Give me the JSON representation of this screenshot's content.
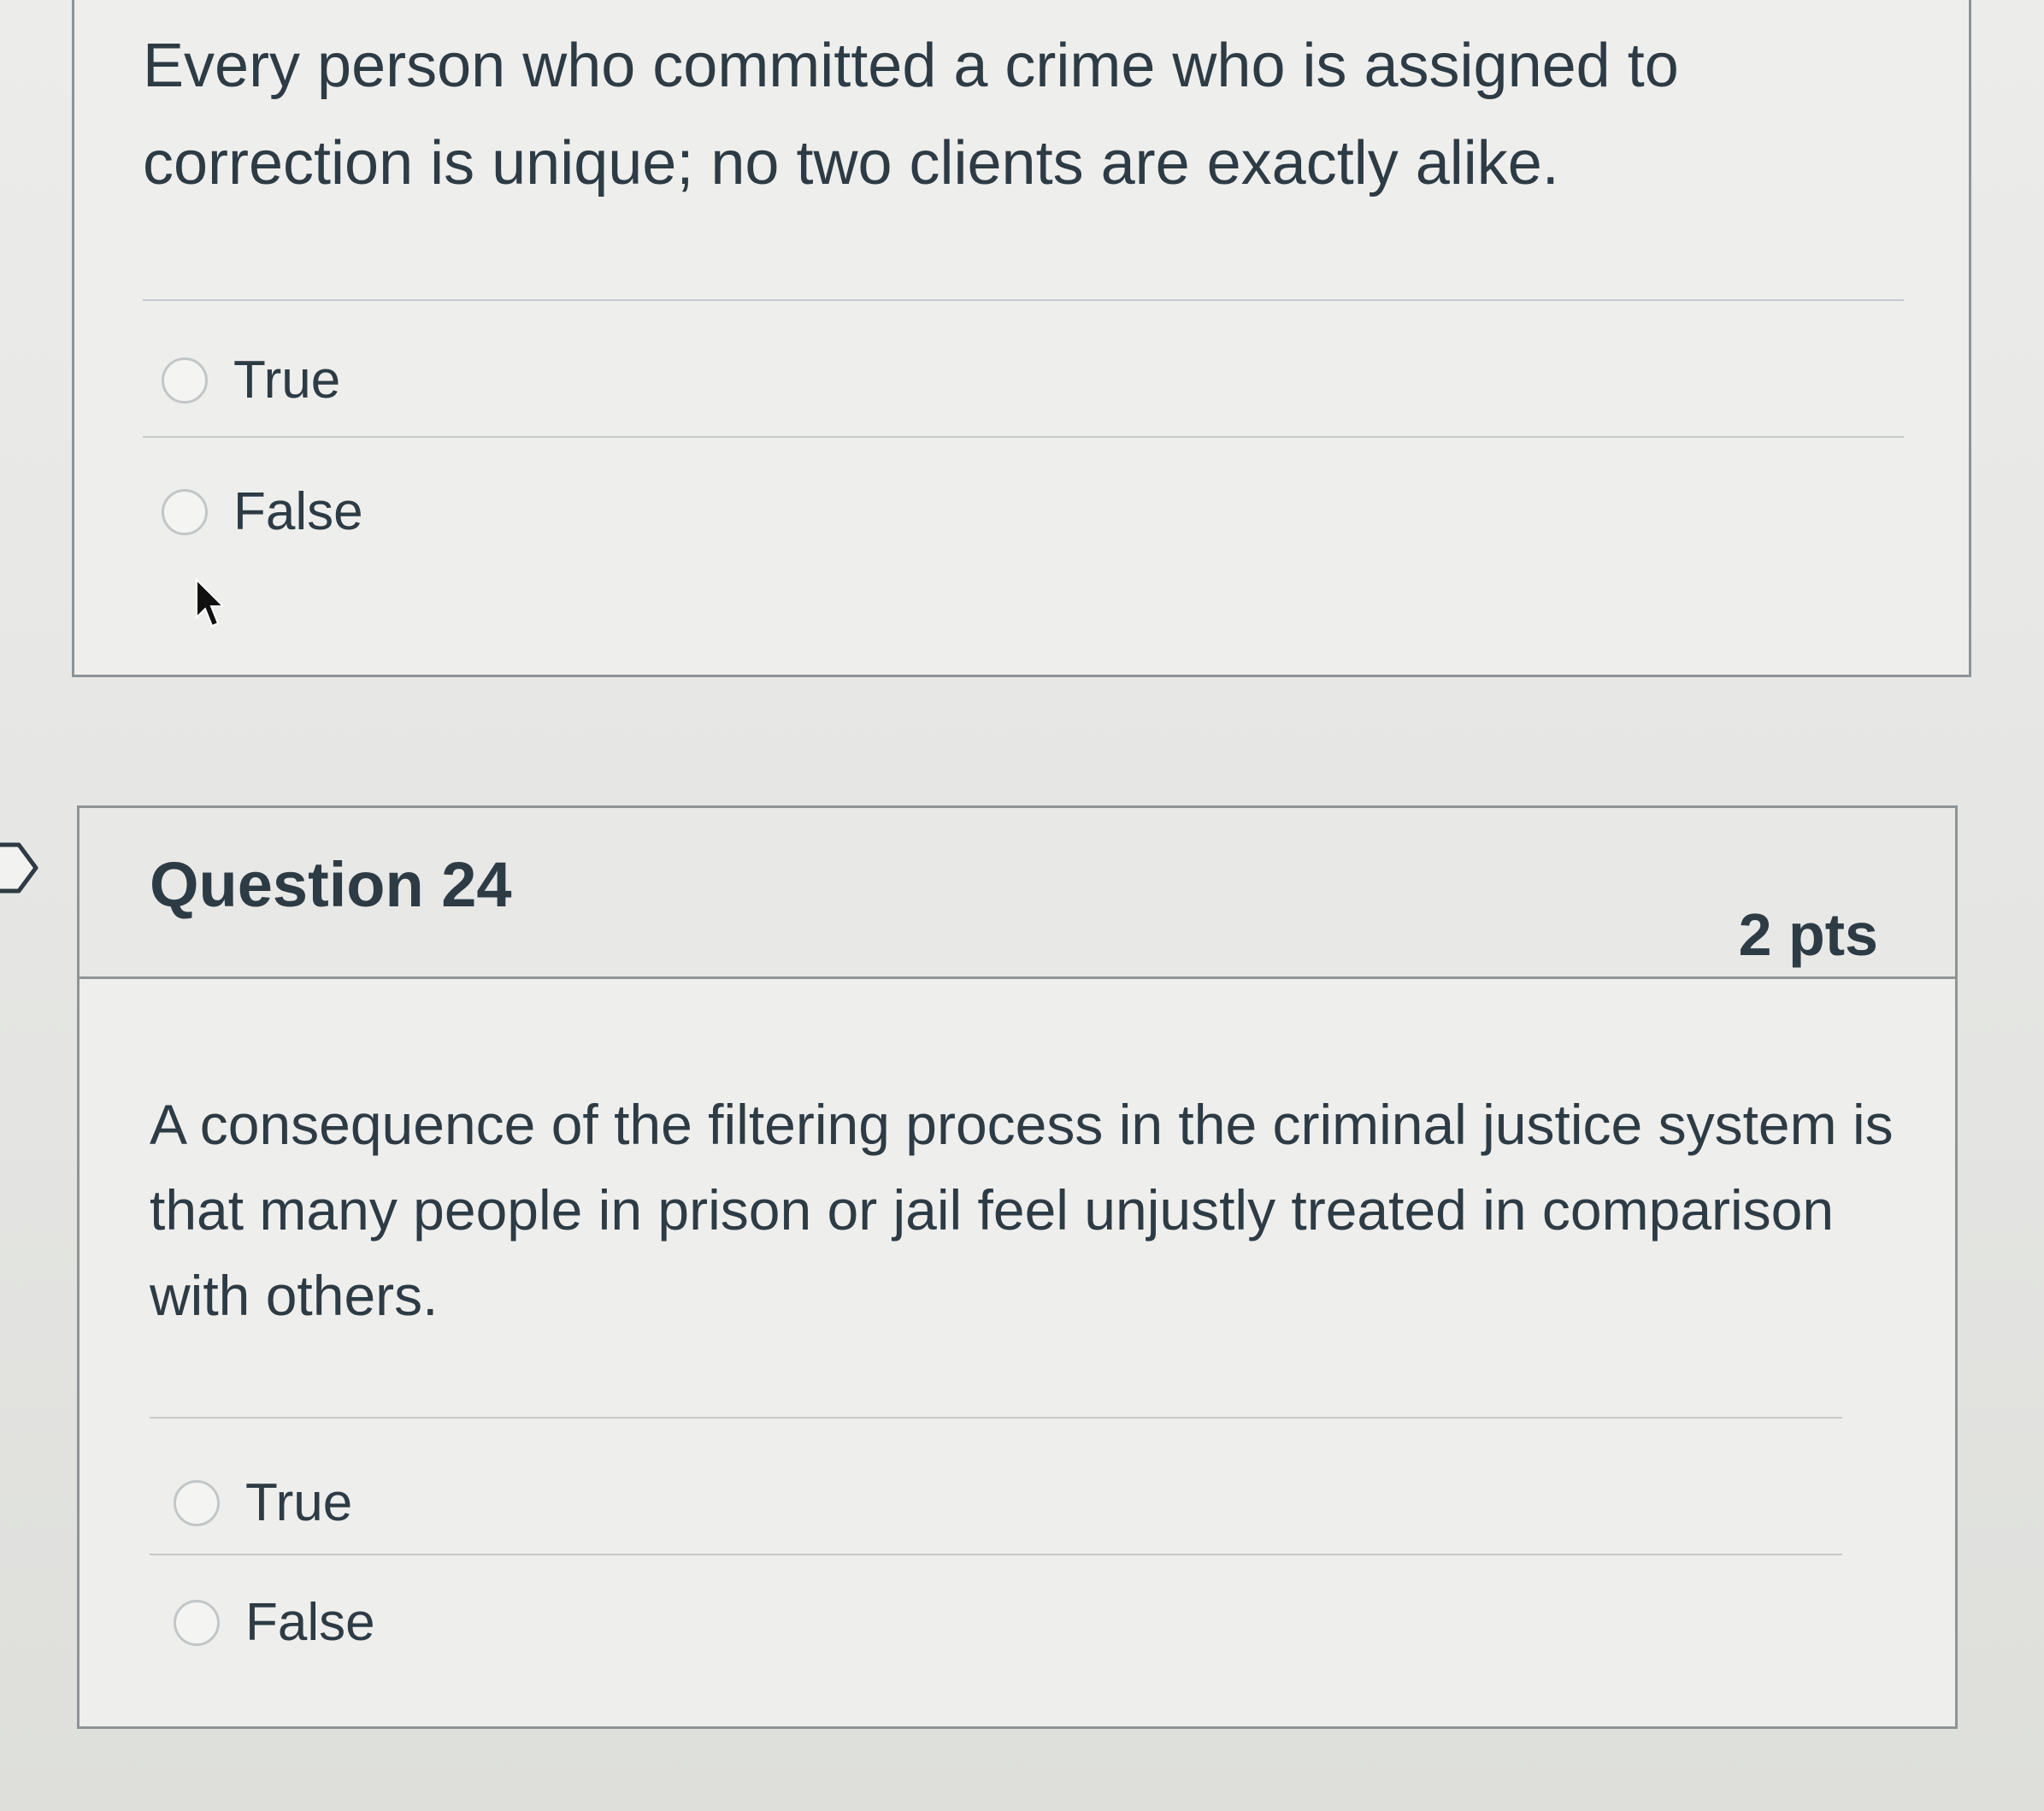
{
  "previous_question": {
    "text": "Every person who committed a crime who is assigned to correction is unique; no two clients are exactly alike.",
    "answers": [
      {
        "label": "True"
      },
      {
        "label": "False"
      }
    ]
  },
  "question_24": {
    "title": "Question 24",
    "points": "2 pts",
    "text": "A consequence of the filtering process in the criminal justice system is that many people in prison or jail feel unjustly treated in comparison with others.",
    "answers": [
      {
        "label": "True"
      },
      {
        "label": "False"
      }
    ]
  },
  "icons": {
    "cursor": "mouse-pointer-icon",
    "side_toggle": "collapse-arrow-icon"
  }
}
